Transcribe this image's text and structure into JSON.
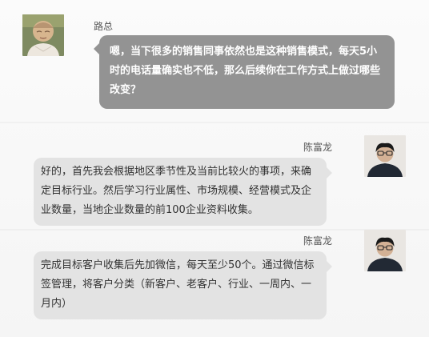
{
  "messages": [
    {
      "sender": "路总",
      "text": "嗯，当下很多的销售同事依然也是这种销售模式，每天5小时的电话量确实也不低，那么后续你在工作方式上做过哪些改变？"
    },
    {
      "sender": "陈富龙",
      "text": "好的，首先我会根据地区季节性及当前比较火的事项，来确定目标行业。然后学习行业属性、市场规模、经营模式及企业数量，当地企业数量的前100企业资料收集。"
    },
    {
      "sender": "陈富龙",
      "text": "完成目标客户收集后先加微信，每天至少50个。通过微信标签管理，将客户分类（新客户、老客户、行业、一周内、一月内）"
    }
  ],
  "colors": {
    "incoming_bubble": "#939393",
    "outgoing_bubble": "#e3e3e3",
    "incoming_text": "#ffffff",
    "outgoing_text": "#333333"
  }
}
